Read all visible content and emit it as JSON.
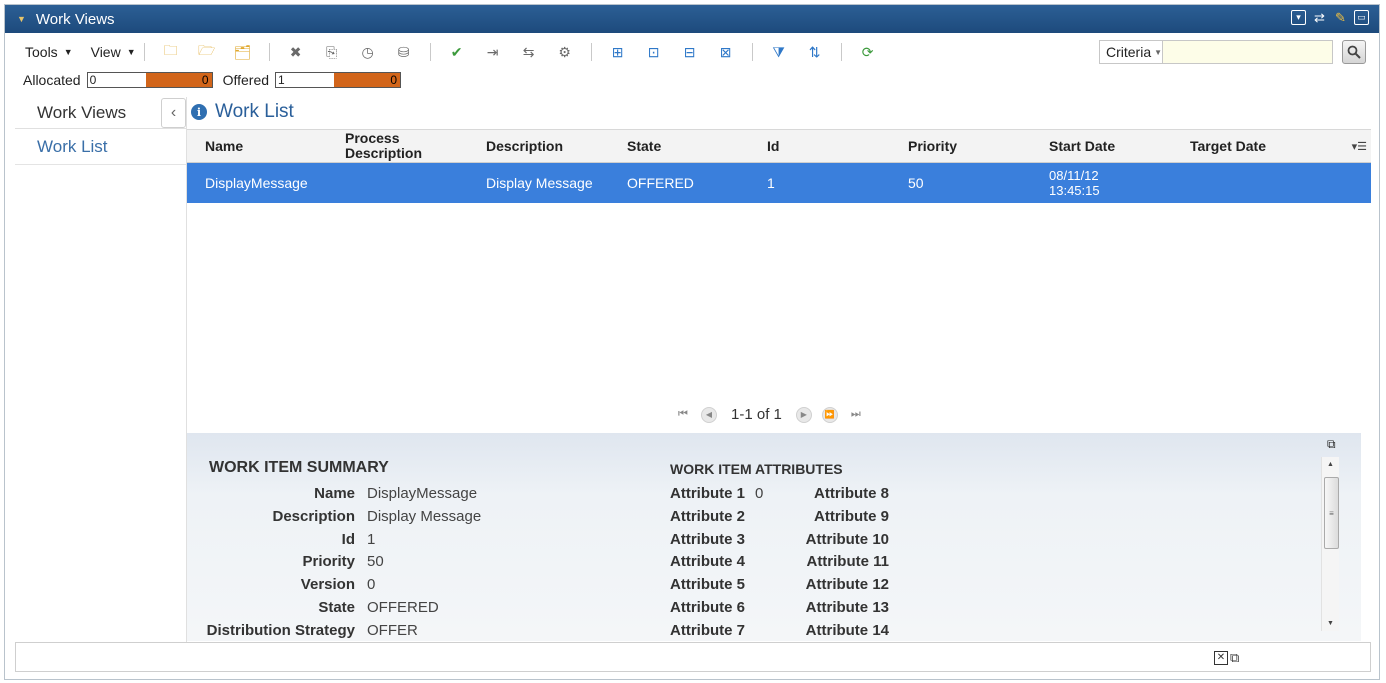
{
  "window": {
    "title": "Work Views"
  },
  "toolbar": {
    "tools_label": "Tools",
    "view_label": "View"
  },
  "search": {
    "criteria_label": "Criteria",
    "placeholder": ""
  },
  "counters": {
    "allocated_label": "Allocated",
    "allocated_value": "0",
    "allocated_bar": "0",
    "offered_label": "Offered",
    "offered_value": "1",
    "offered_bar": "0"
  },
  "sidebar": {
    "header": "Work Views",
    "items": [
      {
        "label": "Work List"
      }
    ]
  },
  "main": {
    "title": "Work List"
  },
  "grid": {
    "columns": [
      "Name",
      "Process Description",
      "Description",
      "State",
      "Id",
      "Priority",
      "Start Date",
      "Target Date"
    ],
    "rows": [
      {
        "name": "DisplayMessage",
        "process_description": "",
        "description": "Display Message",
        "state": "OFFERED",
        "id": "1",
        "priority": "50",
        "start_date_line1": "08/11/12",
        "start_date_line2": "13:45:15",
        "target_date": ""
      }
    ],
    "pager_text": "1-1 of 1"
  },
  "summary": {
    "title": "WORK ITEM SUMMARY",
    "fields": [
      {
        "key": "Name",
        "value": "DisplayMessage"
      },
      {
        "key": "Description",
        "value": "Display Message"
      },
      {
        "key": "Id",
        "value": "1"
      },
      {
        "key": "Priority",
        "value": "50"
      },
      {
        "key": "Version",
        "value": "0"
      },
      {
        "key": "State",
        "value": "OFFERED"
      },
      {
        "key": "Distribution Strategy",
        "value": "OFFER"
      }
    ]
  },
  "attributes": {
    "title": "WORK ITEM ATTRIBUTES",
    "col1": [
      {
        "key": "Attribute 1",
        "value": "0"
      },
      {
        "key": "Attribute 2",
        "value": ""
      },
      {
        "key": "Attribute 3",
        "value": ""
      },
      {
        "key": "Attribute 4",
        "value": ""
      },
      {
        "key": "Attribute 5",
        "value": ""
      },
      {
        "key": "Attribute 6",
        "value": ""
      },
      {
        "key": "Attribute 7",
        "value": ""
      }
    ],
    "col2": [
      {
        "key": "Attribute 8"
      },
      {
        "key": "Attribute 9"
      },
      {
        "key": "Attribute 10"
      },
      {
        "key": "Attribute 11"
      },
      {
        "key": "Attribute 12"
      },
      {
        "key": "Attribute 13"
      },
      {
        "key": "Attribute 14"
      }
    ]
  },
  "colors": {
    "titlebar": "#1d4a7c",
    "selected_row": "#3a7fdc",
    "counter_bar": "#d2651a",
    "link": "#3a6fa8"
  }
}
